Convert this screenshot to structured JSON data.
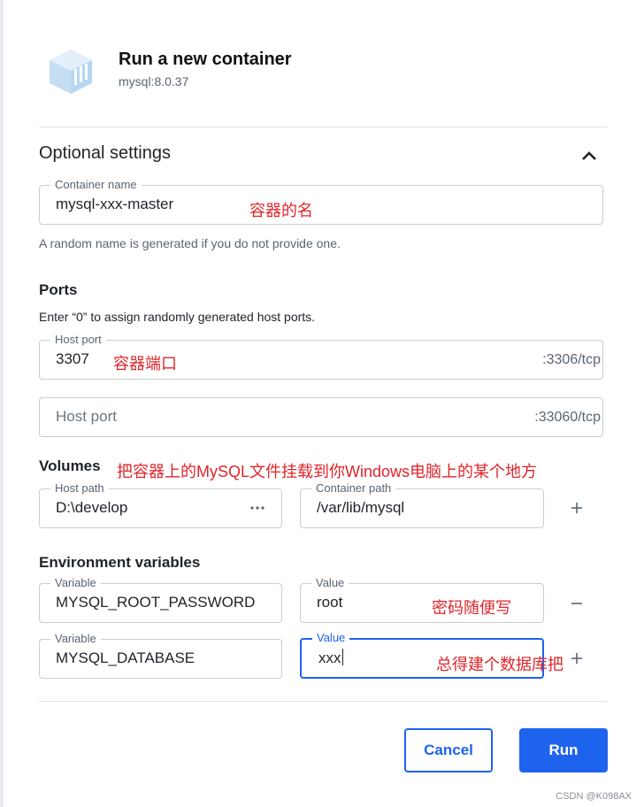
{
  "header": {
    "title": "Run a new container",
    "image_tag": "mysql:8.0.37",
    "logo_icon": "docker-image-cube-icon"
  },
  "optional": {
    "title": "Optional settings",
    "collapse_icon": "chevron-up-icon"
  },
  "container_name": {
    "label": "Container name",
    "value": "mysql-xxx-master",
    "annotation": "容器的名",
    "helper": "A random name is generated if you do not provide one."
  },
  "ports": {
    "title": "Ports",
    "helper": "Enter “0” to assign randomly generated host ports.",
    "port1": {
      "label": "Host port",
      "value": "3307",
      "suffix": ":3306/tcp",
      "annotation": "容器端口"
    },
    "port2": {
      "placeholder": "Host port",
      "suffix": ":33060/tcp"
    }
  },
  "volumes": {
    "title": "Volumes",
    "annotation": "把容器上的MySQL文件挂载到你Windows电脑上的某个地方",
    "host": {
      "label": "Host path",
      "value": "D:\\develop"
    },
    "container": {
      "label": "Container path",
      "value": "/var/lib/mysql"
    },
    "add_icon": "plus-icon",
    "browse_icon": "more-dots-icon"
  },
  "env": {
    "title": "Environment variables",
    "rows": [
      {
        "var_label": "Variable",
        "var_value": "MYSQL_ROOT_PASSWORD",
        "val_label": "Value",
        "val_value": "root",
        "annotation": "密码随便写",
        "action_icon": "minus-icon"
      },
      {
        "var_label": "Variable",
        "var_value": "MYSQL_DATABASE",
        "val_label": "Value",
        "val_value": "xxx",
        "annotation": "总得建个数据库把",
        "action_icon": "plus-icon"
      }
    ]
  },
  "actions": {
    "cancel": "Cancel",
    "run": "Run"
  },
  "watermark": "CSDN @K098AX",
  "colors": {
    "accent": "#1d63ed",
    "annotation": "#e0252a",
    "logo": "#b7d6f2"
  }
}
